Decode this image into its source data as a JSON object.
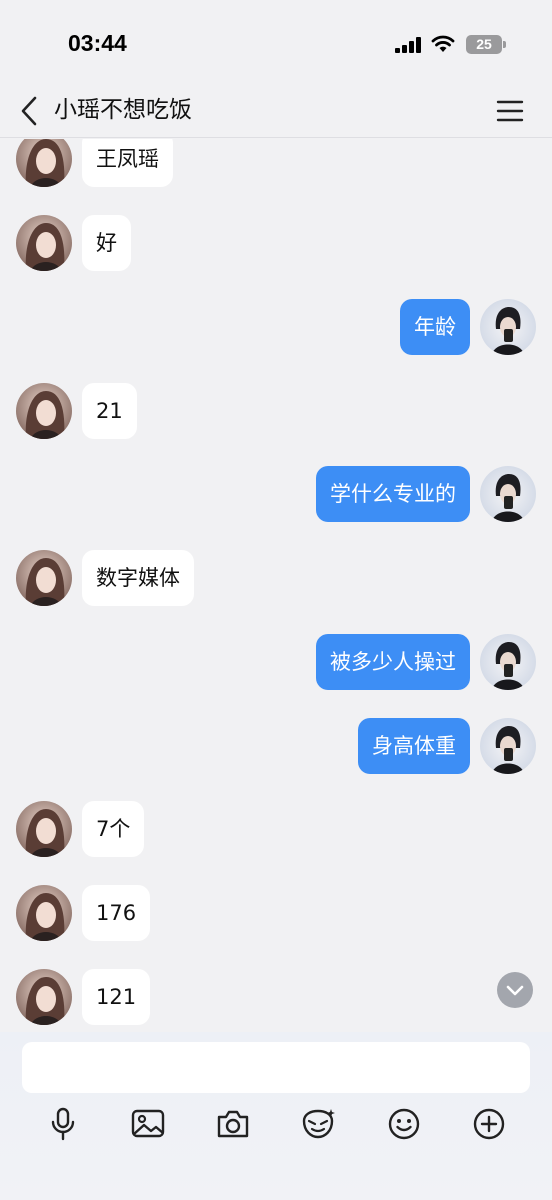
{
  "status_bar": {
    "time": "03:44",
    "battery_level": "25"
  },
  "header": {
    "back_icon": "chevron-left-icon",
    "title": "小瑶不想吃饭",
    "menu_icon": "hamburger-menu-icon"
  },
  "messages": [
    {
      "side": "left",
      "text": "王凤瑶"
    },
    {
      "side": "left",
      "text": "好"
    },
    {
      "side": "right",
      "text": "年龄"
    },
    {
      "side": "left",
      "text": "21"
    },
    {
      "side": "right",
      "text": "学什么专业的"
    },
    {
      "side": "left",
      "text": "数字媒体"
    },
    {
      "side": "right",
      "text": "被多少人操过"
    },
    {
      "side": "right",
      "text": "身高体重"
    },
    {
      "side": "left",
      "text": "7个"
    },
    {
      "side": "left",
      "text": "176"
    },
    {
      "side": "left",
      "text": "121"
    }
  ],
  "input": {
    "value": "",
    "placeholder": ""
  },
  "toolbar": {
    "icons": [
      "microphone-icon",
      "image-icon",
      "camera-icon",
      "sticker-icon",
      "emoji-icon",
      "plus-icon"
    ]
  },
  "colors": {
    "background": "#f1f1f3",
    "sent_bubble": "#3d8ef5",
    "received_bubble": "#ffffff"
  }
}
